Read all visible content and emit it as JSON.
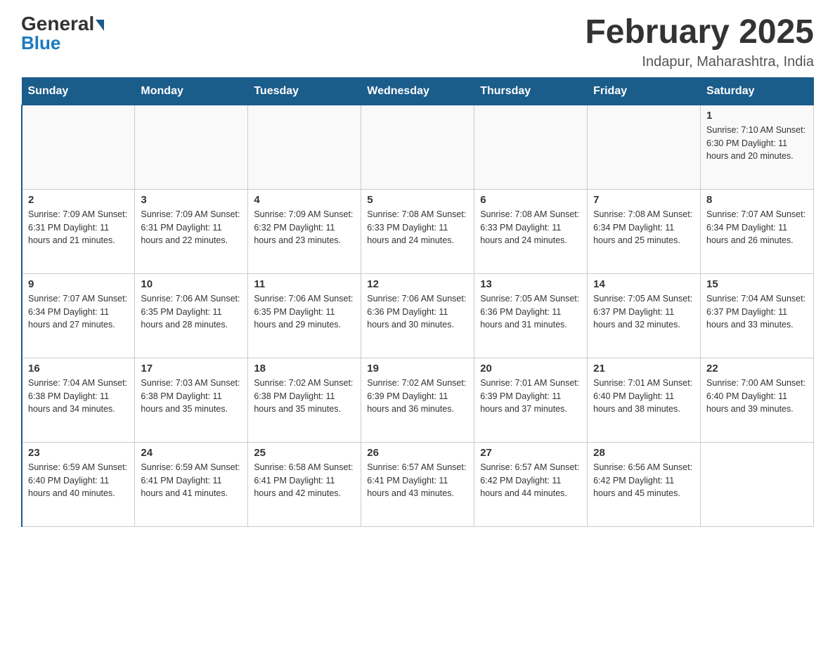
{
  "logo": {
    "part1": "General",
    "part2": "Blue"
  },
  "header": {
    "month_year": "February 2025",
    "location": "Indapur, Maharashtra, India"
  },
  "weekdays": [
    "Sunday",
    "Monday",
    "Tuesday",
    "Wednesday",
    "Thursday",
    "Friday",
    "Saturday"
  ],
  "weeks": [
    [
      {
        "day": "",
        "info": ""
      },
      {
        "day": "",
        "info": ""
      },
      {
        "day": "",
        "info": ""
      },
      {
        "day": "",
        "info": ""
      },
      {
        "day": "",
        "info": ""
      },
      {
        "day": "",
        "info": ""
      },
      {
        "day": "1",
        "info": "Sunrise: 7:10 AM\nSunset: 6:30 PM\nDaylight: 11 hours and 20 minutes."
      }
    ],
    [
      {
        "day": "2",
        "info": "Sunrise: 7:09 AM\nSunset: 6:31 PM\nDaylight: 11 hours and 21 minutes."
      },
      {
        "day": "3",
        "info": "Sunrise: 7:09 AM\nSunset: 6:31 PM\nDaylight: 11 hours and 22 minutes."
      },
      {
        "day": "4",
        "info": "Sunrise: 7:09 AM\nSunset: 6:32 PM\nDaylight: 11 hours and 23 minutes."
      },
      {
        "day": "5",
        "info": "Sunrise: 7:08 AM\nSunset: 6:33 PM\nDaylight: 11 hours and 24 minutes."
      },
      {
        "day": "6",
        "info": "Sunrise: 7:08 AM\nSunset: 6:33 PM\nDaylight: 11 hours and 24 minutes."
      },
      {
        "day": "7",
        "info": "Sunrise: 7:08 AM\nSunset: 6:34 PM\nDaylight: 11 hours and 25 minutes."
      },
      {
        "day": "8",
        "info": "Sunrise: 7:07 AM\nSunset: 6:34 PM\nDaylight: 11 hours and 26 minutes."
      }
    ],
    [
      {
        "day": "9",
        "info": "Sunrise: 7:07 AM\nSunset: 6:34 PM\nDaylight: 11 hours and 27 minutes."
      },
      {
        "day": "10",
        "info": "Sunrise: 7:06 AM\nSunset: 6:35 PM\nDaylight: 11 hours and 28 minutes."
      },
      {
        "day": "11",
        "info": "Sunrise: 7:06 AM\nSunset: 6:35 PM\nDaylight: 11 hours and 29 minutes."
      },
      {
        "day": "12",
        "info": "Sunrise: 7:06 AM\nSunset: 6:36 PM\nDaylight: 11 hours and 30 minutes."
      },
      {
        "day": "13",
        "info": "Sunrise: 7:05 AM\nSunset: 6:36 PM\nDaylight: 11 hours and 31 minutes."
      },
      {
        "day": "14",
        "info": "Sunrise: 7:05 AM\nSunset: 6:37 PM\nDaylight: 11 hours and 32 minutes."
      },
      {
        "day": "15",
        "info": "Sunrise: 7:04 AM\nSunset: 6:37 PM\nDaylight: 11 hours and 33 minutes."
      }
    ],
    [
      {
        "day": "16",
        "info": "Sunrise: 7:04 AM\nSunset: 6:38 PM\nDaylight: 11 hours and 34 minutes."
      },
      {
        "day": "17",
        "info": "Sunrise: 7:03 AM\nSunset: 6:38 PM\nDaylight: 11 hours and 35 minutes."
      },
      {
        "day": "18",
        "info": "Sunrise: 7:02 AM\nSunset: 6:38 PM\nDaylight: 11 hours and 35 minutes."
      },
      {
        "day": "19",
        "info": "Sunrise: 7:02 AM\nSunset: 6:39 PM\nDaylight: 11 hours and 36 minutes."
      },
      {
        "day": "20",
        "info": "Sunrise: 7:01 AM\nSunset: 6:39 PM\nDaylight: 11 hours and 37 minutes."
      },
      {
        "day": "21",
        "info": "Sunrise: 7:01 AM\nSunset: 6:40 PM\nDaylight: 11 hours and 38 minutes."
      },
      {
        "day": "22",
        "info": "Sunrise: 7:00 AM\nSunset: 6:40 PM\nDaylight: 11 hours and 39 minutes."
      }
    ],
    [
      {
        "day": "23",
        "info": "Sunrise: 6:59 AM\nSunset: 6:40 PM\nDaylight: 11 hours and 40 minutes."
      },
      {
        "day": "24",
        "info": "Sunrise: 6:59 AM\nSunset: 6:41 PM\nDaylight: 11 hours and 41 minutes."
      },
      {
        "day": "25",
        "info": "Sunrise: 6:58 AM\nSunset: 6:41 PM\nDaylight: 11 hours and 42 minutes."
      },
      {
        "day": "26",
        "info": "Sunrise: 6:57 AM\nSunset: 6:41 PM\nDaylight: 11 hours and 43 minutes."
      },
      {
        "day": "27",
        "info": "Sunrise: 6:57 AM\nSunset: 6:42 PM\nDaylight: 11 hours and 44 minutes."
      },
      {
        "day": "28",
        "info": "Sunrise: 6:56 AM\nSunset: 6:42 PM\nDaylight: 11 hours and 45 minutes."
      },
      {
        "day": "",
        "info": ""
      }
    ]
  ]
}
